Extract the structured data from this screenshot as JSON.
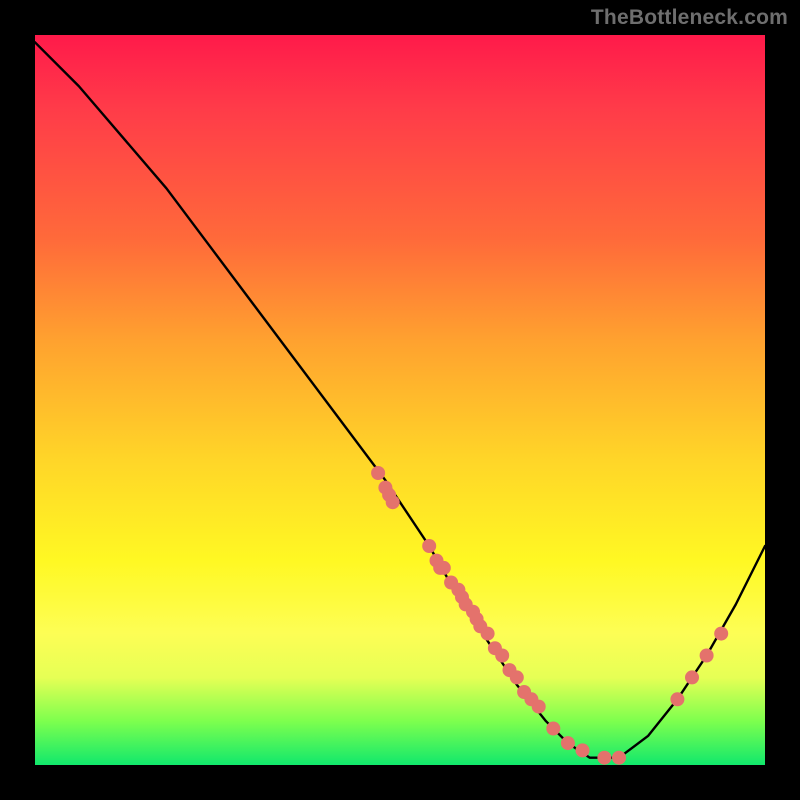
{
  "watermark": "TheBottleneck.com",
  "chart_data": {
    "type": "line",
    "title": "",
    "xlabel": "",
    "ylabel": "",
    "xlim": [
      0,
      100
    ],
    "ylim": [
      0,
      100
    ],
    "curve": {
      "name": "bottleneck-curve",
      "x": [
        0,
        6,
        12,
        18,
        24,
        30,
        36,
        42,
        48,
        54,
        58,
        62,
        66,
        70,
        73,
        76,
        80,
        84,
        88,
        92,
        96,
        100
      ],
      "y": [
        99,
        93,
        86,
        79,
        71,
        63,
        55,
        47,
        39,
        30,
        23,
        17,
        11,
        6,
        3,
        1,
        1,
        4,
        9,
        15,
        22,
        30
      ]
    },
    "points": {
      "name": "sample-points",
      "color": "#e4726c",
      "x": [
        47,
        48,
        48.5,
        49,
        54,
        55,
        55.5,
        56,
        57,
        58,
        58.5,
        59,
        60,
        60.5,
        61,
        62,
        63,
        64,
        65,
        66,
        67,
        68,
        69,
        71,
        73,
        75,
        78,
        80,
        88,
        90,
        92,
        94
      ],
      "y": [
        40,
        38,
        37,
        36,
        30,
        28,
        27,
        27,
        25,
        24,
        23,
        22,
        21,
        20,
        19,
        18,
        16,
        15,
        13,
        12,
        10,
        9,
        8,
        5,
        3,
        2,
        1,
        1,
        9,
        12,
        15,
        18
      ]
    }
  }
}
